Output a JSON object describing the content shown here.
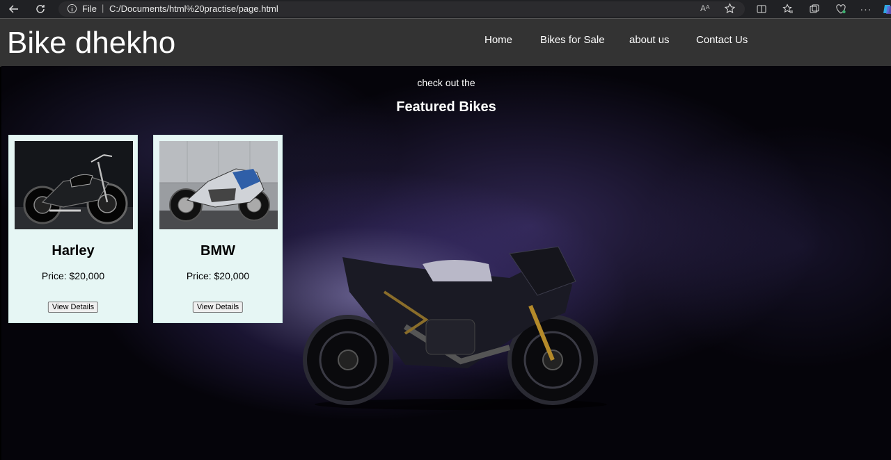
{
  "browser": {
    "file_label": "File",
    "url": "C:/Documents/html%20practise/page.html",
    "read_aloud": "Aᴬ"
  },
  "site": {
    "logo": "Bike dhekho",
    "nav": [
      {
        "label": "Home"
      },
      {
        "label": "Bikes for Sale"
      },
      {
        "label": "about us"
      },
      {
        "label": "Contact Us"
      }
    ]
  },
  "hero": {
    "kicker": "check out the",
    "title": "Featured Bikes",
    "cards": [
      {
        "name": "Harley",
        "price": "Price: $20,000",
        "button": "View Details"
      },
      {
        "name": "BMW",
        "price": "Price: $20,000",
        "button": "View Details"
      }
    ]
  },
  "colors": {
    "header_bg": "#333333",
    "card_bg": "#e6f6f4",
    "browser_bg": "#202124"
  }
}
